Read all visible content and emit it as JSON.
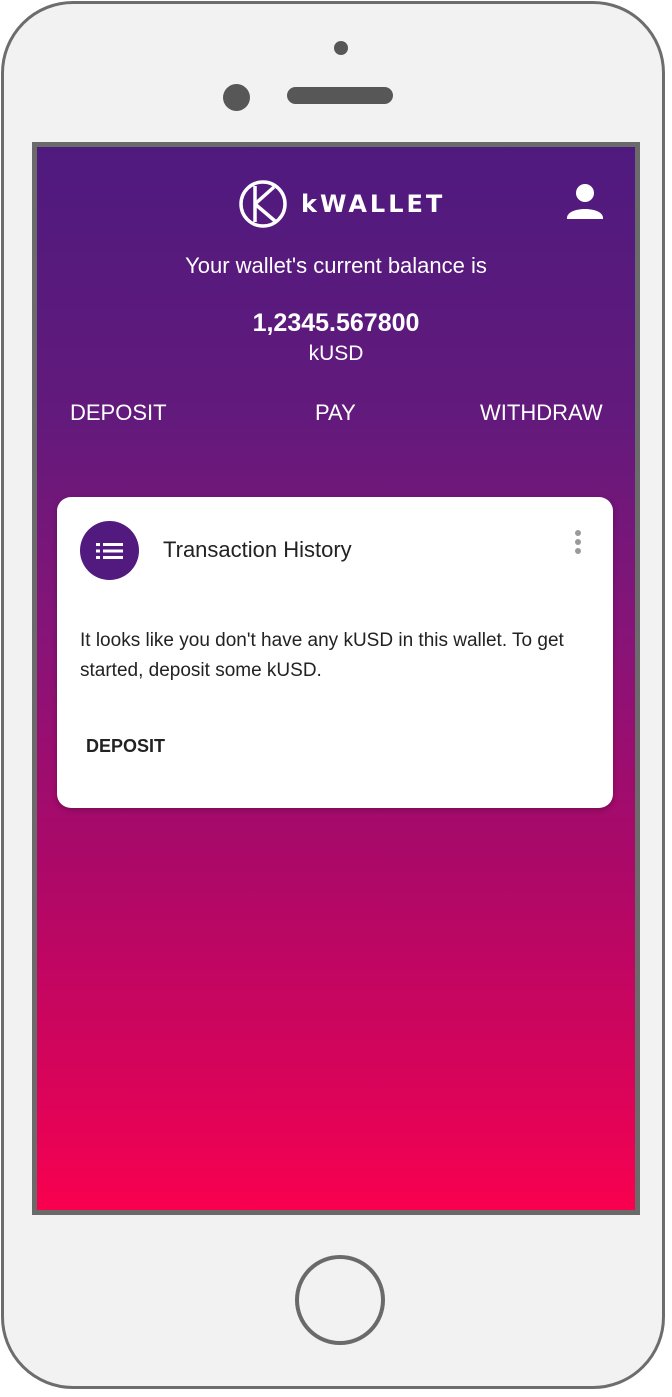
{
  "app": {
    "logo_text": "kWALLET",
    "icons": {
      "logo": "k-circle-logo",
      "account": "person-icon",
      "card_avatar": "list-icon",
      "card_menu": "more-vert-icon"
    },
    "colors": {
      "gradient_top": "#4f1a7e",
      "gradient_bottom": "#fa004f",
      "avatar_bg": "#521a7f",
      "card_bg": "#ffffff"
    }
  },
  "balance": {
    "caption": "Your wallet's current balance is",
    "amount": "1,2345.567800",
    "unit": "kUSD"
  },
  "actions": {
    "deposit": "DEPOSIT",
    "pay": "PAY",
    "withdraw": "WITHDRAW"
  },
  "card": {
    "title": "Transaction History",
    "message": "It looks like you don't have any kUSD in this wallet. To get started, deposit some kUSD.",
    "action_label": "DEPOSIT"
  }
}
